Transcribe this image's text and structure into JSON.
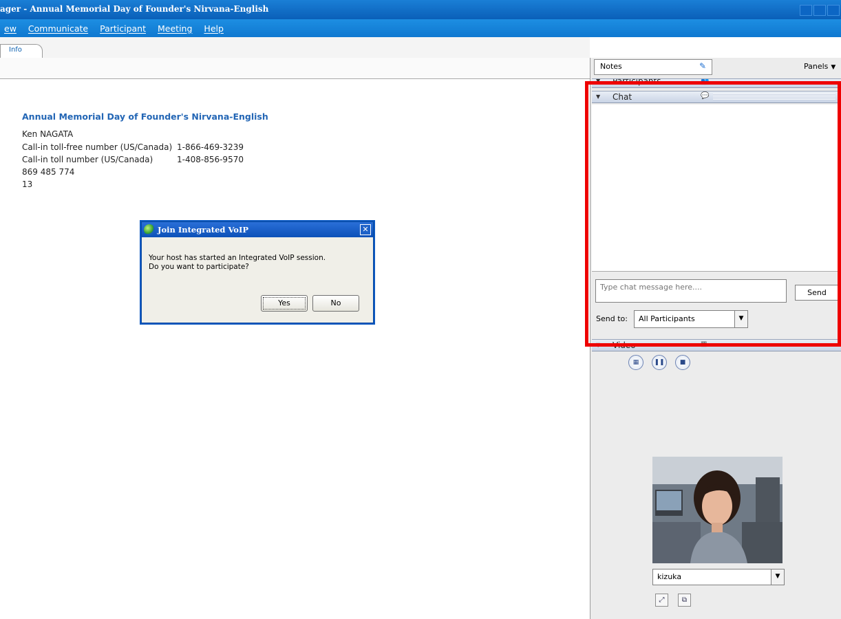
{
  "window": {
    "title": "ager - Annual Memorial Day of Founder's Nirvana-English"
  },
  "menu": {
    "items": [
      "ew",
      "Communicate",
      "Participant",
      "Meeting",
      "Help"
    ]
  },
  "tabs": {
    "active": "Info"
  },
  "info": {
    "title": "Annual Memorial Day of Founder's Nirvana-English",
    "host": "Ken NAGATA",
    "tollfree_label": "Call-in toll-free number (US/Canada)",
    "tollfree_number": "1-866-469-3239",
    "toll_label": "Call-in toll number (US/Canada)",
    "toll_number": "1-408-856-9570",
    "meeting_number": "869 485 774",
    "attendee_id": "13"
  },
  "dialog": {
    "title": "Join Integrated VoIP",
    "message_line1": "Your host has started an Integrated VoIP session.",
    "message_line2": "Do you want to participate?",
    "yes_label": "Yes",
    "no_label": "No"
  },
  "right_panel": {
    "notes_label": "Notes",
    "panels_label": "Panels",
    "participants_label": "Participants",
    "chat_label": "Chat",
    "chat_placeholder": "Type chat message here....",
    "send_label": "Send",
    "send_to_label": "Send to:",
    "send_to_value": "All Participants",
    "video_label": "Video",
    "video_user": "kizuka"
  },
  "icons": {
    "notes": "pencil-icon",
    "participants": "people-icon",
    "chat": "speech-bubble-icon",
    "video": "video-grid-icon"
  },
  "colors": {
    "titlebar": "#0a5fb8",
    "menubar": "#1480d8",
    "info_title": "#2366b5",
    "highlight": "#ee0000"
  }
}
